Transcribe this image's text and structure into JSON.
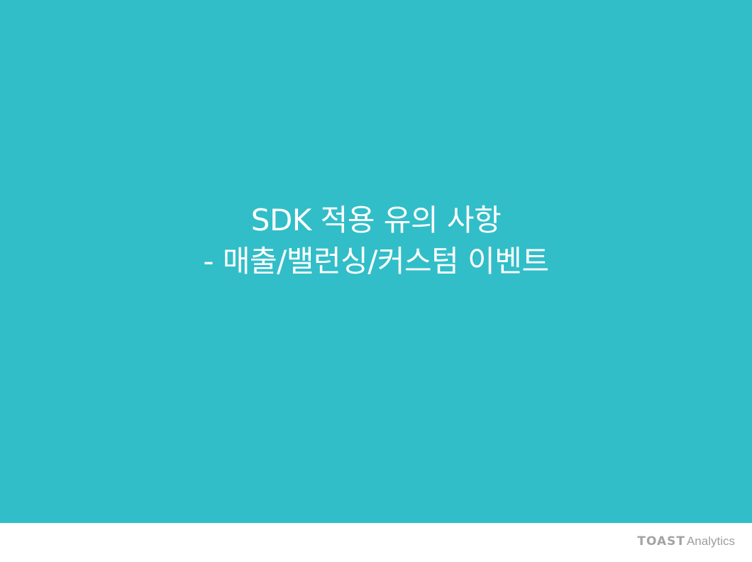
{
  "slide": {
    "background_color": "#31bec8",
    "title_lines": [
      "SDK 적용 유의 사항",
      "- 매출/밸런싱/커스텀 이벤트"
    ]
  },
  "footer": {
    "logo_brand": "TOAST",
    "logo_product": "Analytics"
  }
}
